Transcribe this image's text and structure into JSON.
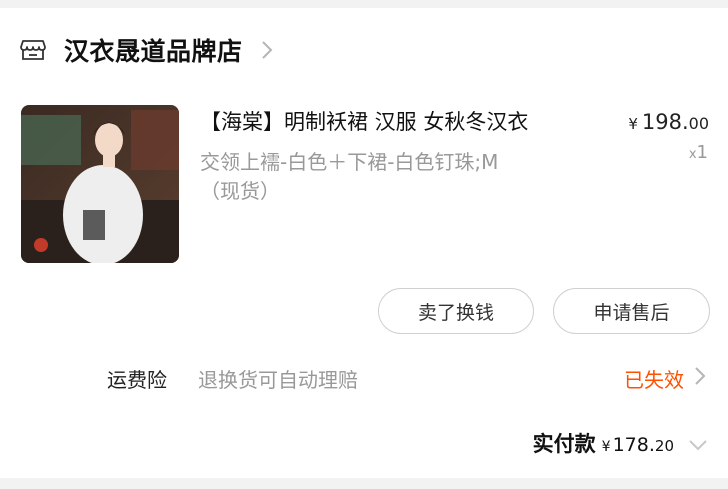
{
  "shop": {
    "name": "汉衣晟道品牌店",
    "icon": "store-icon"
  },
  "product": {
    "title": "【海棠】明制袄裙 汉服 女秋冬汉衣",
    "sku_line1": "交领上襦-白色＋下裙-白色钉珠;M",
    "sku_line2": "（现货）",
    "price_currency": "¥",
    "price_int": "198.",
    "price_dec": "00",
    "qty_prefix": "x",
    "qty_value": "1"
  },
  "actions": {
    "sell_label": "卖了换钱",
    "service_label": "申请售后"
  },
  "insurance": {
    "label": "运费险",
    "desc": "退换货可自动理赔",
    "status": "已失效",
    "status_color": "#ff5000"
  },
  "total": {
    "label": "实付款",
    "currency": "¥",
    "int": "178.",
    "dec": "20"
  }
}
